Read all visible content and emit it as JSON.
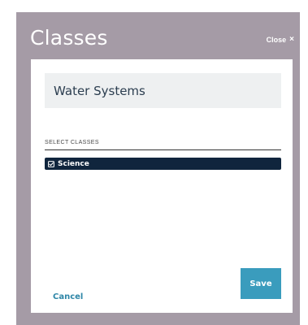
{
  "modal": {
    "title": "Classes",
    "close_label": "Close",
    "close_icon": "close-icon"
  },
  "item_name": "Water Systems",
  "select_classes": {
    "label": "SELECT CLASSES",
    "options": [
      {
        "label": "Science",
        "checked": true,
        "icon": "checkbox-checked-icon"
      }
    ]
  },
  "footer": {
    "cancel_label": "Cancel",
    "save_label": "Save"
  },
  "colors": {
    "frame": "#a59ba6",
    "panel": "#ffffff",
    "name_box": "#eef0f1",
    "selected_option": "#10253d",
    "accent": "#3a9cbd",
    "link": "#2e86a7"
  }
}
